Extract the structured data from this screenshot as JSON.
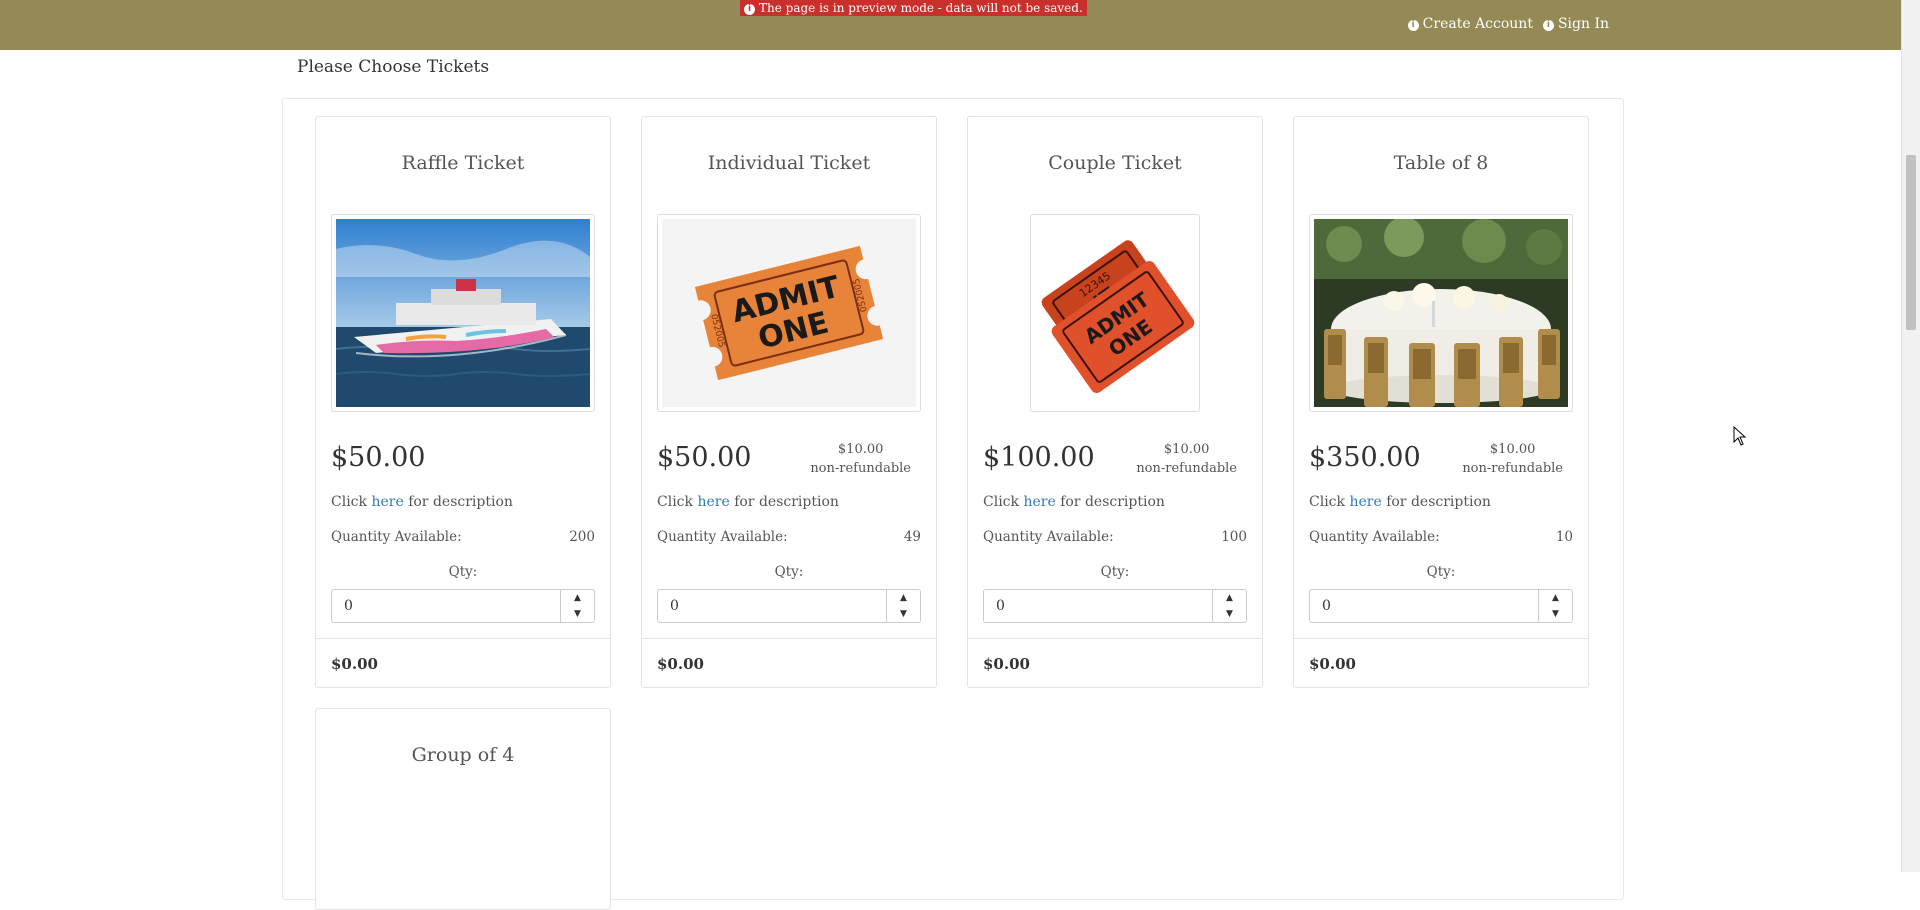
{
  "banner": {
    "text": "The page is in preview mode - data will not be saved."
  },
  "nav": {
    "create_account": "Create Account",
    "sign_in": "Sign In"
  },
  "page": {
    "title": "Please Choose Tickets"
  },
  "tickets": [
    {
      "name": "Raffle Ticket",
      "image": "cruise-ship",
      "price": "$50.00",
      "fee_amount": "",
      "fee_note": "",
      "desc_prefix": "Click",
      "desc_link": "here",
      "desc_suffix": "for description",
      "qty_available_label": "Quantity Available:",
      "qty_available": "200",
      "qty_label": "Qty:",
      "qty_value": "0",
      "subtotal": "$0.00"
    },
    {
      "name": "Individual Ticket",
      "image": "admit-one-ticket",
      "price": "$50.00",
      "fee_amount": "$10.00",
      "fee_note": "non-refundable",
      "desc_prefix": "Click",
      "desc_link": "here",
      "desc_suffix": "for description",
      "qty_available_label": "Quantity Available:",
      "qty_available": "49",
      "qty_label": "Qty:",
      "qty_value": "0",
      "subtotal": "$0.00"
    },
    {
      "name": "Couple Ticket",
      "image": "two-admit-one-tickets",
      "price": "$100.00",
      "fee_amount": "$10.00",
      "fee_note": "non-refundable",
      "desc_prefix": "Click",
      "desc_link": "here",
      "desc_suffix": "for description",
      "qty_available_label": "Quantity Available:",
      "qty_available": "100",
      "qty_label": "Qty:",
      "qty_value": "0",
      "subtotal": "$0.00"
    },
    {
      "name": "Table of 8",
      "image": "banquet-table",
      "price": "$350.00",
      "fee_amount": "$10.00",
      "fee_note": "non-refundable",
      "desc_prefix": "Click",
      "desc_link": "here",
      "desc_suffix": "for description",
      "qty_available_label": "Quantity Available:",
      "qty_available": "10",
      "qty_label": "Qty:",
      "qty_value": "0",
      "subtotal": "$0.00"
    },
    {
      "name": "Group of 4"
    }
  ],
  "colors": {
    "topbar": "#958a55",
    "banner": "#c9302c",
    "link": "#337ab7"
  }
}
